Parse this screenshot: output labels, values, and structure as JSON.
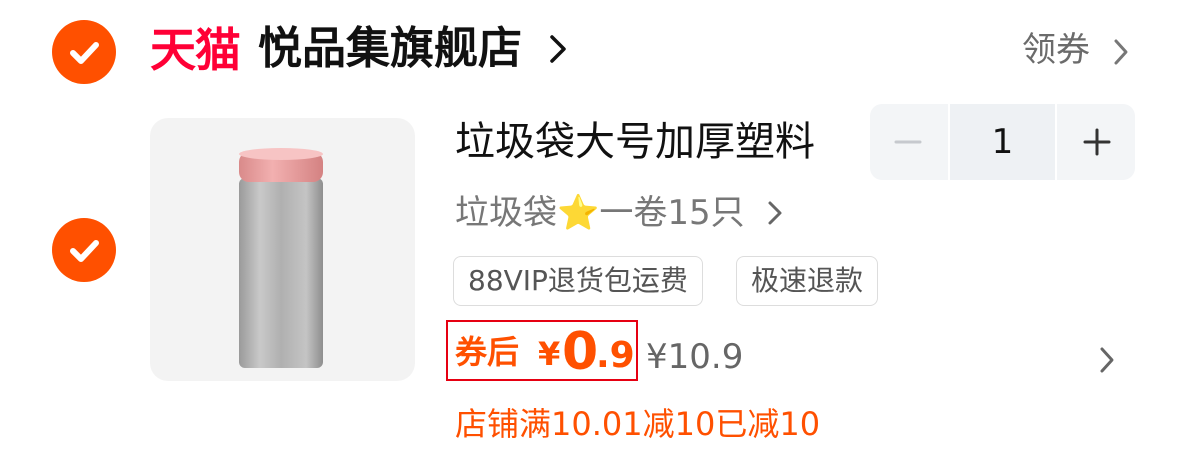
{
  "store": {
    "logo_text": "天猫",
    "name": "悦品集旗舰店",
    "coupon_label": "领券"
  },
  "item": {
    "title": "垃圾袋大号加厚塑料",
    "sku_prefix": "垃圾袋",
    "sku_star": "⭐",
    "sku_suffix": "一卷15只",
    "tags": [
      "88VIP退货包运费",
      "极速退款"
    ],
    "price_label": "券后",
    "price_currency": "¥",
    "price_int": "0",
    "price_dec": ".9",
    "original_price": "¥10.9",
    "promo_text": "店铺满10.01减10已减10",
    "quantity": "1"
  },
  "colors": {
    "accent": "#ff5000",
    "tmall_red": "#ff0036",
    "highlight_border": "#e60012"
  },
  "icons": {
    "store_check": "check-circle-icon",
    "item_check": "check-circle-icon",
    "chevron": "chevron-right-icon"
  }
}
